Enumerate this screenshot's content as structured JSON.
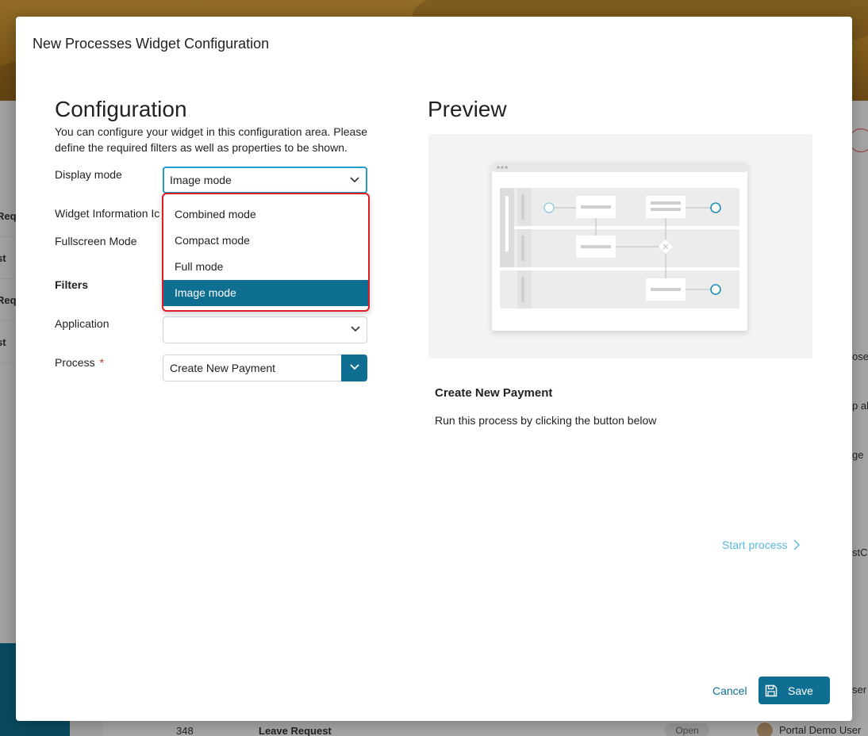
{
  "modal": {
    "title": "New Processes Widget Configuration"
  },
  "configuration": {
    "heading": "Configuration",
    "description": "You can configure your widget in this configuration area. Please define the required filters as well as properties to be shown.",
    "display_mode": {
      "label": "Display mode",
      "value": "Image mode",
      "options": [
        "Combined mode",
        "Compact mode",
        "Full mode",
        "Image mode"
      ],
      "selected_index": 3
    },
    "widget_information_label": "Widget Information Ic",
    "fullscreen_label": "Fullscreen Mode",
    "filters_heading": "Filters",
    "application": {
      "label": "Application",
      "value": ""
    },
    "process": {
      "label": "Process",
      "required_marker": "*",
      "value": "Create New Payment"
    }
  },
  "preview": {
    "heading": "Preview",
    "card_title": "Create New Payment",
    "card_text": "Run this process by clicking the button below",
    "start_label": "Start process"
  },
  "footer": {
    "cancel_label": "Cancel",
    "save_label": "Save"
  },
  "background": {
    "left_fragments": [
      "Req",
      "st",
      "Req",
      "st"
    ],
    "right_fragments": [
      "ose",
      "p al",
      "ge",
      "stC",
      "ser"
    ],
    "row_number": "348",
    "row_title": "Leave Request",
    "row_status": "Open",
    "row_user": "Portal Demo User"
  },
  "colors": {
    "primary": "#0f6f92",
    "focus": "#1f9fd0",
    "highlight_border": "#e01b24",
    "link": "#5bb9dc"
  }
}
